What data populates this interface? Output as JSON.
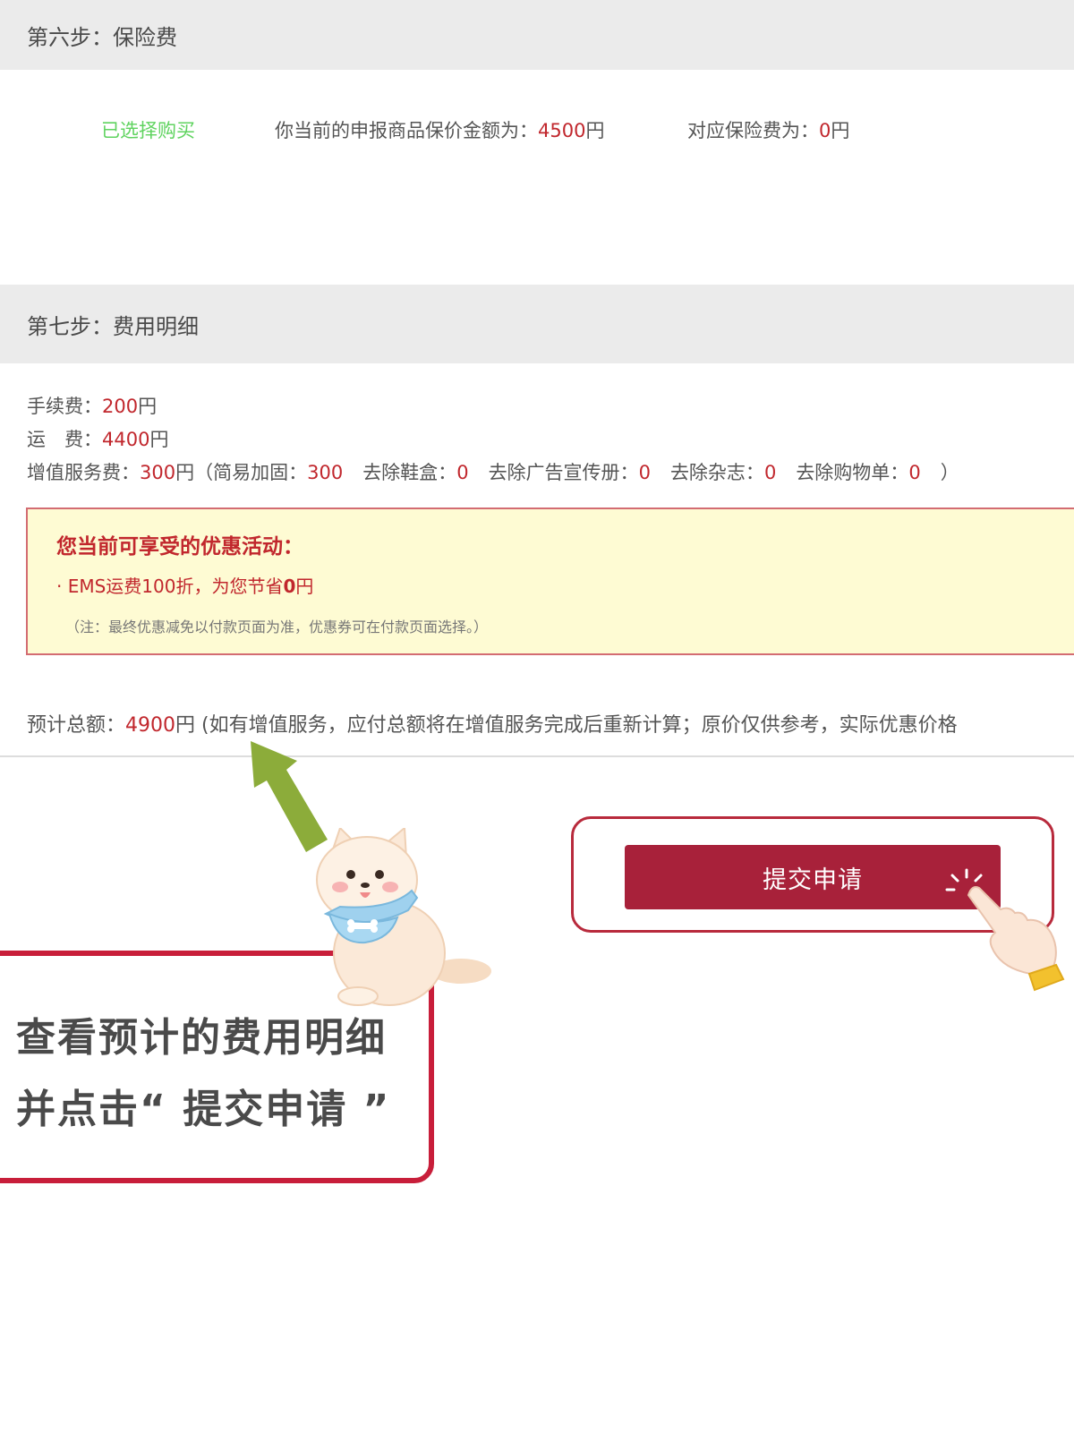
{
  "step6": {
    "title": "第六步：保险费"
  },
  "insurance": {
    "selected": "已选择购买",
    "amount_label": "你当前的申报商品保价金额为：",
    "amount_value": "4500",
    "amount_unit": "円",
    "fee_label": "对应保险费为：",
    "fee_value": "0",
    "fee_unit": "円"
  },
  "step7": {
    "title": "第七步：费用明细"
  },
  "fees": {
    "handling_label": "手续费：",
    "handling_value": "200",
    "handling_unit": "円",
    "shipping_label": "运　费：",
    "shipping_value": "4400",
    "shipping_unit": "円",
    "service_label": "增值服务费：",
    "service_value": "300",
    "service_unit": "円",
    "paren_open": "（",
    "paren_close": "）",
    "service_items": [
      {
        "label": "简易加固：",
        "value": "300"
      },
      {
        "label": "去除鞋盒：",
        "value": "0"
      },
      {
        "label": "去除广告宣传册：",
        "value": "0"
      },
      {
        "label": "去除杂志：",
        "value": "0"
      },
      {
        "label": "去除购物单：",
        "value": "0"
      }
    ]
  },
  "promo": {
    "title": "您当前可享受的优惠活动：",
    "line_prefix": "· EMS运费100折，为您节省",
    "line_value": "0",
    "line_unit": "円",
    "note": "（注：最终优惠减免以付款页面为准，优惠券可在付款页面选择。）"
  },
  "total": {
    "label": "预计总额：",
    "value": "4900",
    "unit": "円",
    "note": " (如有增值服务，应付总额将在增值服务完成后重新计算；原价仅供参考，实际优惠价格"
  },
  "submit": {
    "label": "提交申请"
  },
  "callout": {
    "line1": "查看预计的费用明细",
    "line2": "并点击“ 提交申请 ”"
  },
  "colors": {
    "accent_red": "#c1272d",
    "button_red": "#a8213a",
    "green": "#5fd35f",
    "promo_bg": "#fefbd3",
    "arrow_green": "#8cac3a"
  }
}
